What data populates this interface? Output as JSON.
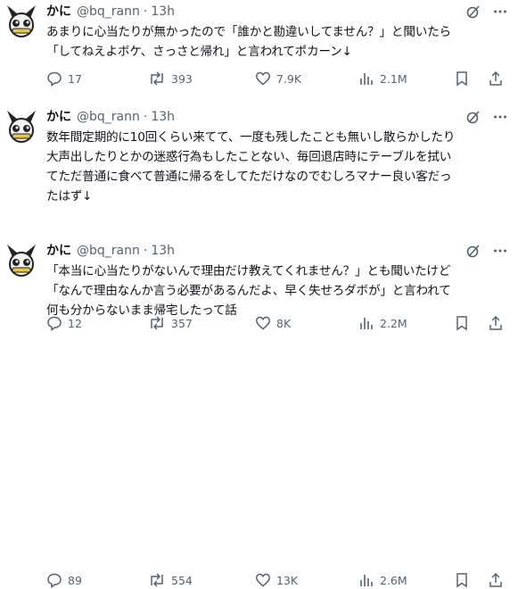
{
  "tweets": [
    {
      "name": "かに",
      "handle": "@bq_rann",
      "dot": "·",
      "time": "13h",
      "lines": [
        "あまりに心当たりが無かったので「誰かと勘違いしてません？」と聞いたら",
        "「してねえよボケ、さっさと帰れ」と言われてポカーン↓"
      ],
      "replies": "17",
      "reposts": "393",
      "likes": "7.9K",
      "views": "2.1M"
    },
    {
      "name": "かに",
      "handle": "@bq_rann",
      "dot": "·",
      "time": "13h",
      "lines": [
        "数年間定期的に10回くらい来てて、一度も残したことも無いし散らかしたり",
        "大声出したりとかの迷惑行為もしたことない、毎回退店時にテーブルを拭い",
        "てただ普通に食べて普通に帰るをしてただけなのでむしろマナー良い客だっ",
        "たはず↓"
      ],
      "replies": "12",
      "reposts": "357",
      "likes": "8K",
      "views": "2.2M"
    },
    {
      "name": "かに",
      "handle": "@bq_rann",
      "dot": "·",
      "time": "13h",
      "lines": [
        "「本当に心当たりがないんで理由だけ教えてくれません？」とも聞いたけど",
        "「なんで理由なんか言う必要があるんだよ、早く失せろダボが」と言われて",
        "何も分からないまま帰宅したって話"
      ],
      "replies": "89",
      "reposts": "554",
      "likes": "13K",
      "views": "2.6M"
    }
  ],
  "icons": {
    "avatar": "mascot-avatar-icon",
    "grok": "grok-icon",
    "more": "more-icon",
    "reply": "reply-icon",
    "repost": "repost-icon",
    "like": "like-icon",
    "views": "views-icon",
    "bookmark": "bookmark-icon",
    "share": "share-icon"
  }
}
